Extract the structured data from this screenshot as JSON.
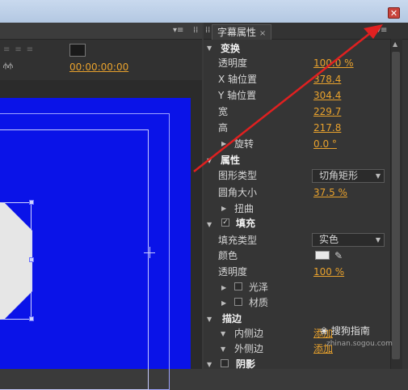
{
  "tab": {
    "title": "字幕属性",
    "close": "×"
  },
  "left": {
    "timecode": "00:00:00:00"
  },
  "sections": {
    "transform": "变换",
    "properties": "属性",
    "fill": "填充",
    "stroke": "描边",
    "shadow": "阴影"
  },
  "transform": {
    "opacity_label": "透明度",
    "opacity": "100.0 %",
    "x_label": "X 轴位置",
    "x": "378.4",
    "y_label": "Y 轴位置",
    "y": "304.4",
    "width_label": "宽",
    "width": "229.7",
    "height_label": "高",
    "height": "217.8",
    "rotation_label": "旋转",
    "rotation": "0.0 °"
  },
  "properties": {
    "shape_type_label": "图形类型",
    "shape_type": "切角矩形",
    "corner_label": "圆角大小",
    "corner": "37.5 %",
    "distort_label": "扭曲"
  },
  "fill": {
    "fill_type_label": "填充类型",
    "fill_type": "实色",
    "color_label": "颜色",
    "opacity_label": "透明度",
    "opacity": "100 %",
    "sheen_label": "光泽",
    "texture_label": "材质"
  },
  "stroke": {
    "inner_label": "内侧边",
    "inner_add": "添加",
    "outer_label": "外侧边",
    "outer_add": "添加"
  },
  "watermark": {
    "text": "搜狗指南",
    "url": "zhinan.sogou.com"
  },
  "colors": {
    "accent": "#e9a22d",
    "canvas": "#0a13e8",
    "arrow": "#e02020"
  }
}
